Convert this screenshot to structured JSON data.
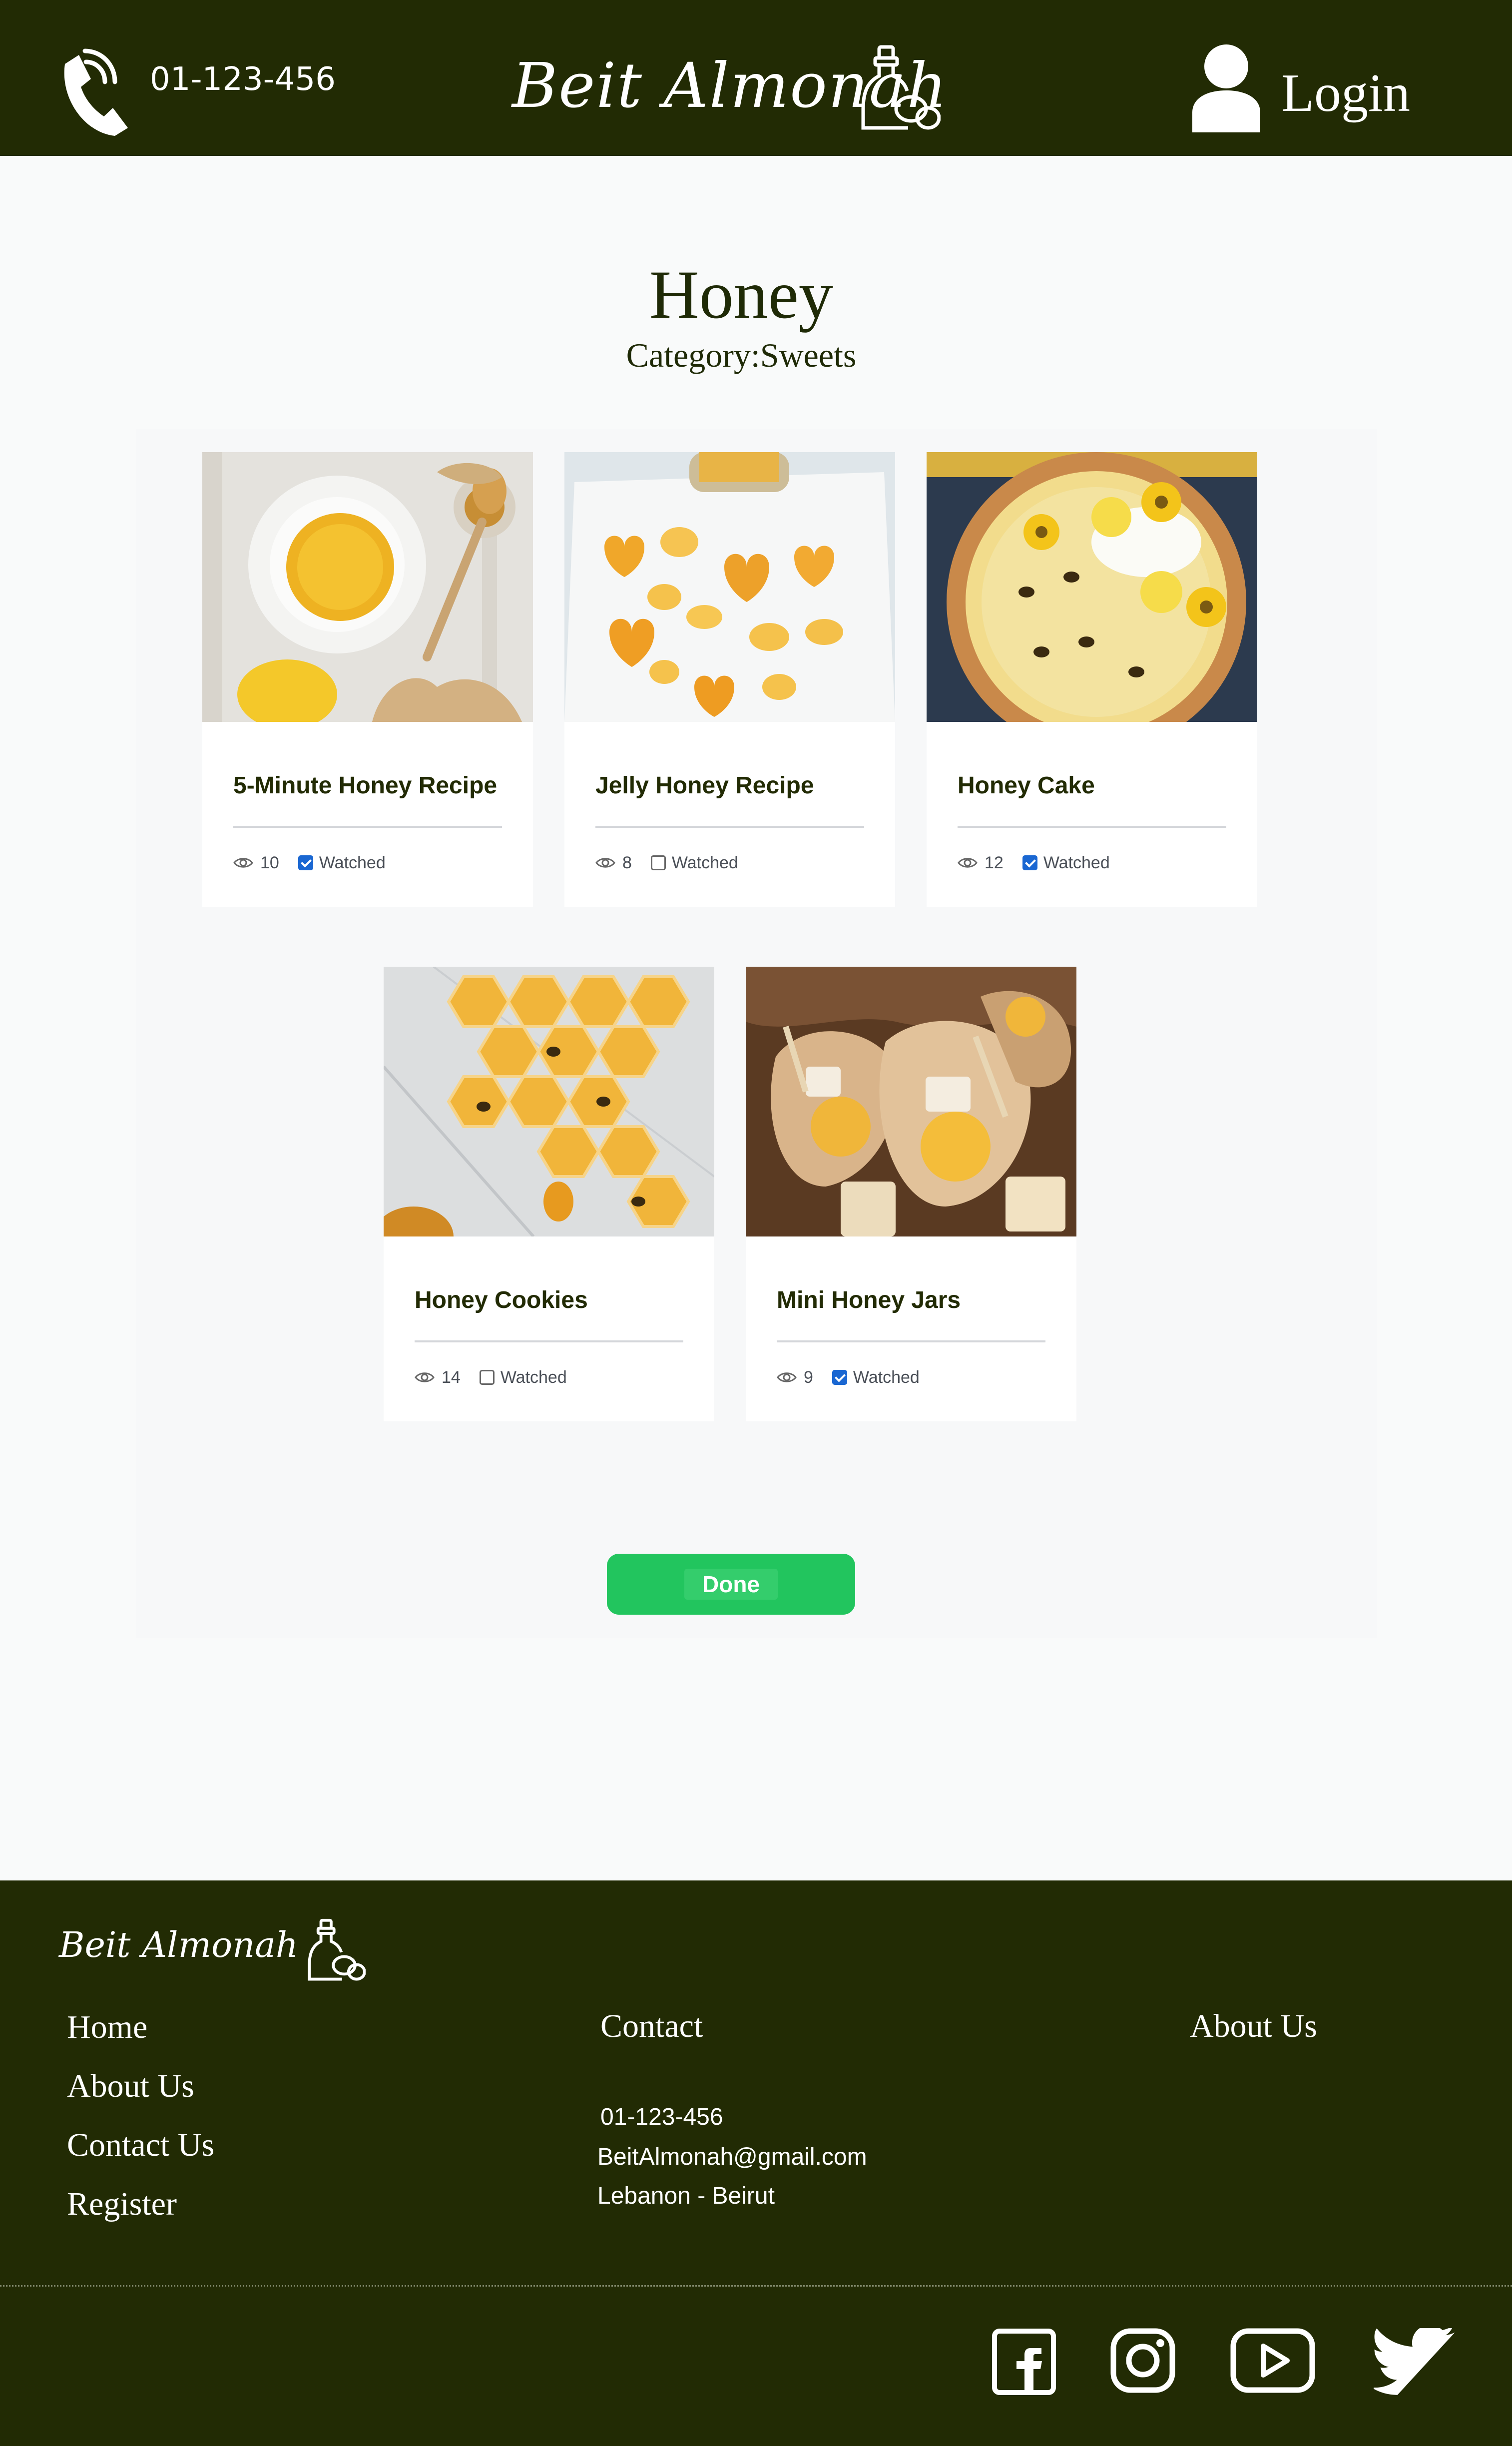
{
  "header": {
    "phone": "01-123-456",
    "brand": "Beit Almonah",
    "login_label": "Login"
  },
  "page": {
    "title": "Honey",
    "category_label": "Category:",
    "category_value": "Sweets"
  },
  "cards": [
    {
      "title": "5-Minute Honey Recipe",
      "views": "10",
      "watched": true,
      "watched_label": "Watched",
      "image": "honey-tea-photo"
    },
    {
      "title": "Jelly Honey Recipe",
      "views": "8",
      "watched": false,
      "watched_label": "Watched",
      "image": "honey-gummies-photo"
    },
    {
      "title": "Honey Cake",
      "views": "12",
      "watched": true,
      "watched_label": "Watched",
      "image": "honey-cake-photo"
    },
    {
      "title": "Honey Cookies",
      "views": "14",
      "watched": false,
      "watched_label": "Watched",
      "image": "honey-cookies-photo"
    },
    {
      "title": "Mini Honey Jars",
      "views": "9",
      "watched": true,
      "watched_label": "Watched",
      "image": "mini-honey-jars-photo"
    }
  ],
  "done_label": "Done",
  "footer": {
    "brand": "Beit Almonah",
    "links": [
      "Home",
      "About Us",
      "Contact Us",
      "Register"
    ],
    "contact_heading": "Contact",
    "phone": "01-123-456",
    "email": "BeitAlmonah@gmail.com",
    "address": "Lebanon - Beirut",
    "about_heading": "About Us",
    "social": [
      "facebook-icon",
      "instagram-icon",
      "youtube-icon",
      "twitter-icon"
    ]
  },
  "colors": {
    "header_bg": "#222b04",
    "accent_green": "#22c55e",
    "checkbox_blue": "#1a67d2"
  }
}
